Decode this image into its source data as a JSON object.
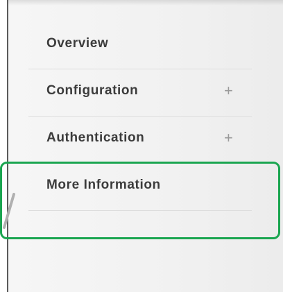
{
  "sidebar": {
    "items": [
      {
        "label": "Overview",
        "expandable": false,
        "expand_icon": ""
      },
      {
        "label": "Configuration",
        "expandable": true,
        "expand_icon": "+"
      },
      {
        "label": "Authentication",
        "expandable": true,
        "expand_icon": "+"
      },
      {
        "label": "More Information",
        "expandable": false,
        "expand_icon": ""
      }
    ]
  },
  "annotation": {
    "highlighted_item": "More Information",
    "highlight_color": "#1aa550"
  },
  "colors": {
    "text": "#3c3c3c",
    "divider": "#dddddd",
    "plus": "#9a9a9a",
    "panel_border": "#5a5a5a"
  }
}
